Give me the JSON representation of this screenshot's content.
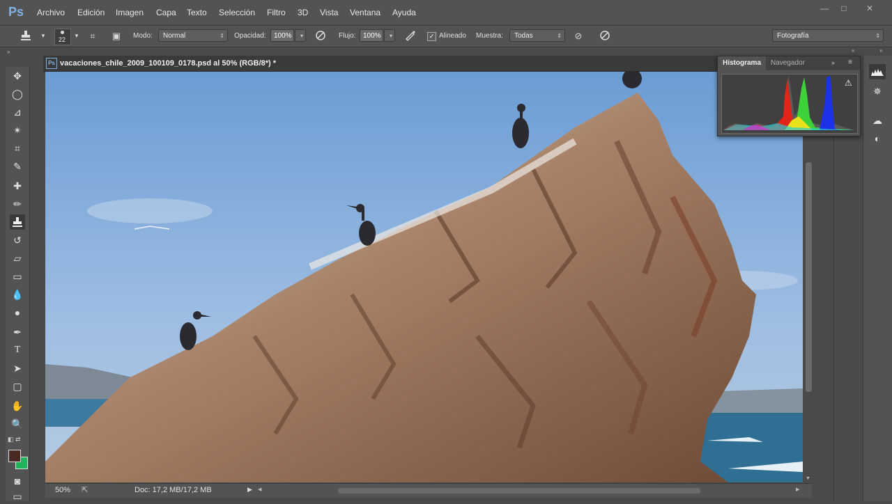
{
  "app": {
    "logo": "Ps"
  },
  "menu": [
    "Archivo",
    "Edición",
    "Imagen",
    "Capa",
    "Texto",
    "Selección",
    "Filtro",
    "3D",
    "Vista",
    "Ventana",
    "Ayuda"
  ],
  "window_controls": {
    "minimize": "—",
    "restore": "□",
    "close": "✕"
  },
  "options_bar": {
    "brush_size": "22",
    "mode_label": "Modo:",
    "mode_value": "Normal",
    "opacity_label": "Opacidad:",
    "opacity_value": "100%",
    "flow_label": "Flujo:",
    "flow_value": "100%",
    "aligned_label": "Alineado",
    "aligned_checked": true,
    "sample_label": "Muestra:",
    "sample_value": "Todas",
    "workspace_value": "Fotografía"
  },
  "document": {
    "title": "vacaciones_chile_2009_100109_0178.psd al 50% (RGB/8*) *",
    "tab_icon": "Ps"
  },
  "status_bar": {
    "zoom": "50%",
    "doc_info": "Doc: 17,2 MB/17,2 MB"
  },
  "panels": {
    "histogram_tab": "Histograma",
    "navigator_tab": "Navegador"
  },
  "tools": [
    "move-tool",
    "marquee-tool",
    "lasso-tool",
    "magic-wand-tool",
    "crop-tool",
    "eyedropper-tool",
    "healing-brush-tool",
    "brush-tool",
    "clone-stamp-tool",
    "history-brush-tool",
    "eraser-tool",
    "gradient-tool",
    "blur-tool",
    "dodge-tool",
    "pen-tool",
    "type-tool",
    "path-selection-tool",
    "shape-tool",
    "hand-tool",
    "zoom-tool"
  ],
  "colors": {
    "foreground": "#4a2a24",
    "background": "#1fb35a",
    "accent": "#7fb2e5"
  }
}
